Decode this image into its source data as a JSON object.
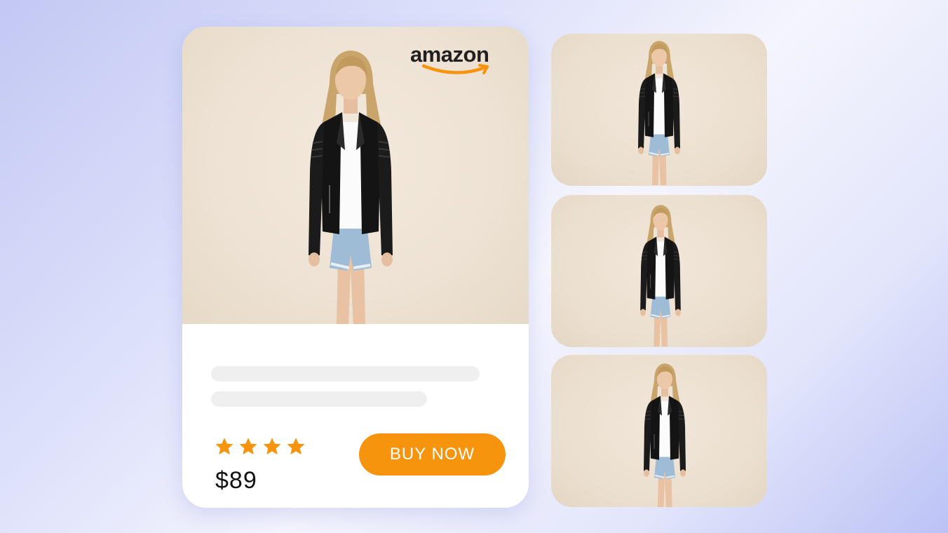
{
  "brand": {
    "name": "amazon",
    "icon": "amazon-logo",
    "smile_color": "#f7940e"
  },
  "product": {
    "title_placeholder_lines": 2,
    "rating": {
      "stars": 4,
      "max": 4,
      "icon": "star-icon",
      "color": "#f7940e"
    },
    "price": "$89",
    "buy_button_label": "BUY NOW",
    "accent_color": "#f7940e"
  },
  "gallery": {
    "main_image": "model-leather-jacket-front",
    "thumbnails": [
      {
        "id": "model-hands-on-hips"
      },
      {
        "id": "model-holding-jacket"
      },
      {
        "id": "model-side-pose"
      }
    ]
  }
}
